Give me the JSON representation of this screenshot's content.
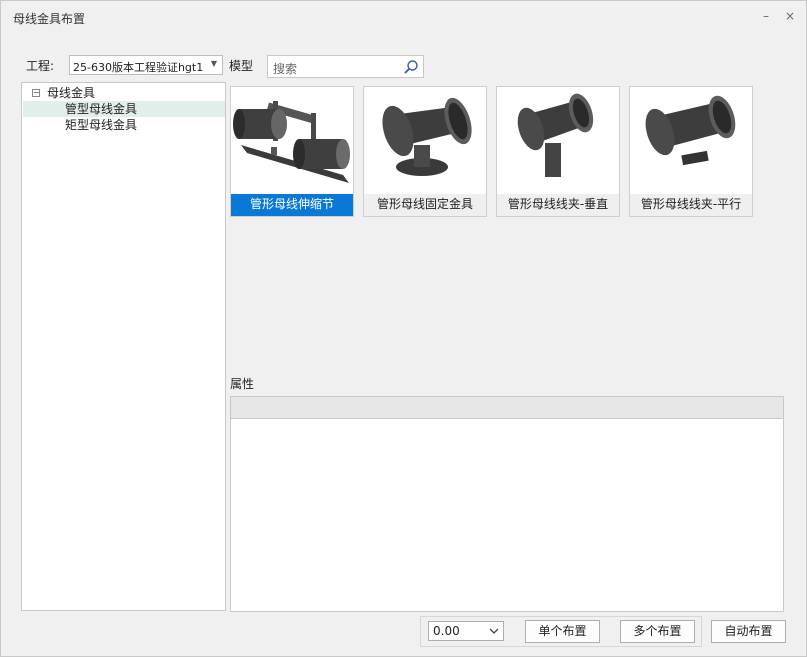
{
  "window": {
    "title": "母线金具布置",
    "minimize_glyph": "–",
    "close_glyph": "×"
  },
  "project": {
    "label": "工程:",
    "selected": "25-630版本工程验证hgt1"
  },
  "tree": {
    "root": {
      "label": "母线金具",
      "expander": "−"
    },
    "children": [
      {
        "label": "管型母线金具",
        "selected": true
      },
      {
        "label": "矩型母线金具",
        "selected": false
      }
    ]
  },
  "model": {
    "label": "模型",
    "search_placeholder": "搜索",
    "items": [
      {
        "caption": "管形母线伸缩节",
        "icon": "expansion-joint-icon",
        "selected": true
      },
      {
        "caption": "管形母线固定金具",
        "icon": "fixed-fitting-icon",
        "selected": false
      },
      {
        "caption": "管形母线线夹-垂直",
        "icon": "vertical-clamp-icon",
        "selected": false
      },
      {
        "caption": "管形母线线夹-平行",
        "icon": "parallel-clamp-icon",
        "selected": false
      }
    ]
  },
  "properties": {
    "label": "属性"
  },
  "footer": {
    "value": "0.00",
    "buttons": {
      "single": "单个布置",
      "multiple": "多个布置",
      "auto": "自动布置"
    }
  },
  "colors": {
    "accent": "#0a78d7",
    "tree_selected": "#e2eee9"
  }
}
